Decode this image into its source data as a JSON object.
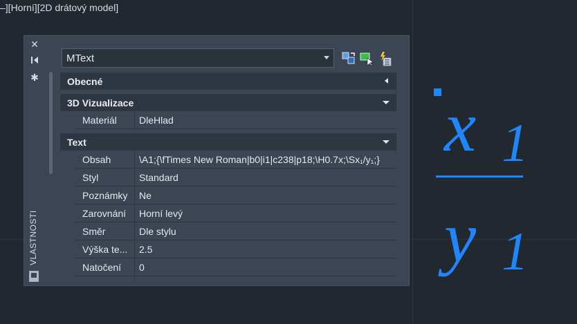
{
  "viewport": {
    "label": "–][Horní][2D drátový model]"
  },
  "palette": {
    "vertical_title": "VLASTNOSTI",
    "close_icon": "close-icon",
    "autohide_icon": "autohide-icon",
    "settings_icon": "gear-icon",
    "object_type": "MText",
    "toolbar": {
      "toggle_pickadd": "pickadd-toggle-icon",
      "select_objects": "select-objects-icon",
      "quick_select": "quick-select-icon"
    },
    "sections": [
      {
        "title": "Obecné",
        "state": "collapsed"
      },
      {
        "title": "3D Vizualizace",
        "state": "expanded",
        "rows": [
          {
            "key": "Materiál",
            "value": "DleHlad"
          }
        ]
      },
      {
        "title": "Text",
        "state": "expanded",
        "rows": [
          {
            "key": "Obsah",
            "value": "\\A1;{\\fTimes New Roman|b0|i1|c238|p18;\\H0.7x;\\Sx₁/y₁;}"
          },
          {
            "key": "Styl",
            "value": "Standard"
          },
          {
            "key": "Poznámky",
            "value": "Ne"
          },
          {
            "key": "Zarovnání",
            "value": "Horní levý"
          },
          {
            "key": "Směr",
            "value": "Dle stylu"
          },
          {
            "key": "Výška te...",
            "value": "2.5"
          },
          {
            "key": "Natočení",
            "value": "0"
          }
        ]
      }
    ]
  },
  "drawing": {
    "numerator": "x",
    "numerator_sub": "1",
    "denominator": "y",
    "denominator_sub": "1",
    "text_color": "#1f86ff"
  }
}
